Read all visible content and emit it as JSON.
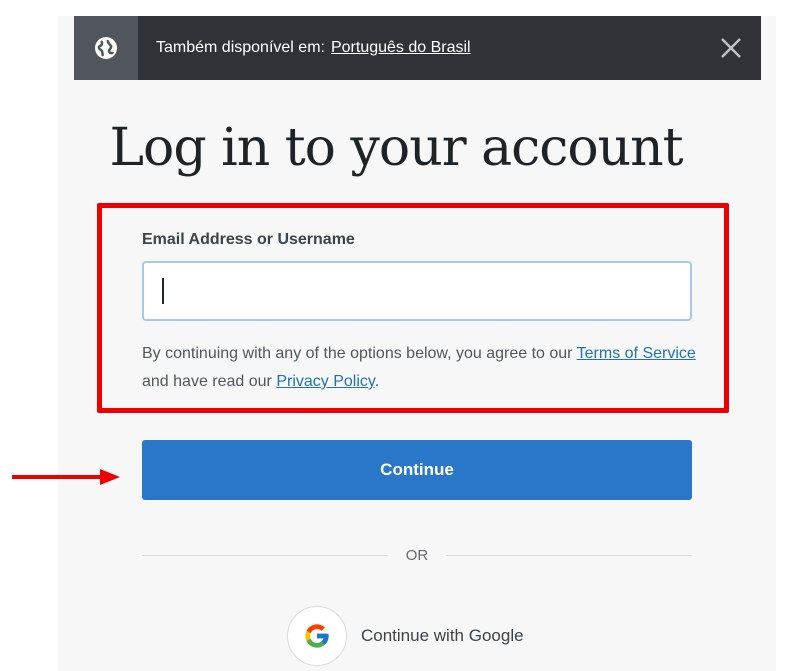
{
  "banner": {
    "text": "Também disponível em:",
    "link": "Português do Brasil"
  },
  "title": "Log in to your account",
  "form": {
    "label": "Email Address or Username",
    "value": "",
    "terms_prefix": "By continuing with any of the options below, you agree to our",
    "terms_link": "Terms of Service",
    "terms_middle": "and have read our",
    "privacy_link": "Privacy Policy",
    "terms_suffix": "."
  },
  "continue_label": "Continue",
  "or_label": "OR",
  "google_label": "Continue with Google",
  "colors": {
    "accent": "#2a77c9",
    "highlight": "#ee0000",
    "banner_bg": "#2f3338"
  },
  "icons": [
    "globe-icon",
    "close-icon",
    "google-icon",
    "arrow-annotation"
  ]
}
